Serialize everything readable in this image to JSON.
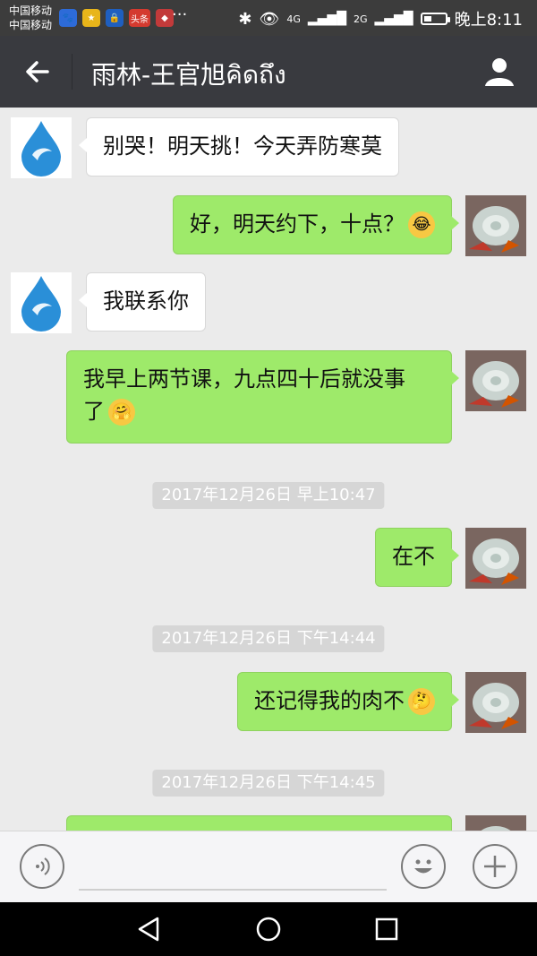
{
  "status_bar": {
    "carrier_1": "中国移动",
    "carrier_2": "中国移动",
    "app_icons": [
      "baidu-icon",
      "star-icon",
      "lock-icon",
      "toutiao-icon",
      "red-app-icon"
    ],
    "toutiao_label": "头条",
    "more": "···",
    "network_4g": "4G",
    "network_2g": "2G",
    "battery_level": 0.4,
    "time": "晚上8:11"
  },
  "header": {
    "title": "雨林-王官旭คิดถึง"
  },
  "messages": [
    {
      "side": "left",
      "text": "别哭！明天挑！今天弄防寒莫"
    },
    {
      "side": "right",
      "text": "好，明天约下，十点？",
      "emoji": "laugh-cry-emoji"
    },
    {
      "side": "left",
      "text": "我联系你"
    },
    {
      "side": "right",
      "line1": "我早上两节课，九点四十后就没事",
      "line2": "了",
      "emoji": "hug-emoji"
    },
    {
      "side": "right",
      "text": "在不"
    },
    {
      "side": "right",
      "text": "还记得我的肉不",
      "emoji": "thinking-emoji"
    }
  ],
  "timestamps": [
    "2017年12月26日 早上10:47",
    "2017年12月26日 下午14:44",
    "2017年12月26日 下午14:45"
  ],
  "colors": {
    "header_bg": "#393a3f",
    "chat_bg": "#ebebeb",
    "bubble_self": "#9eea6a",
    "bubble_other": "#ffffff"
  }
}
